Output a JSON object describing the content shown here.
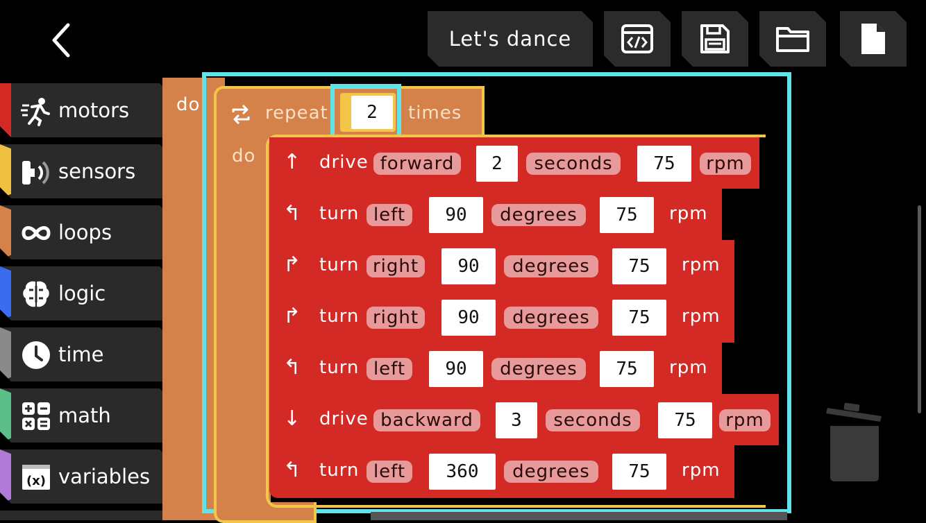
{
  "toolbar": {
    "project_name": "Let's dance",
    "back_icon": "chevron-left-icon",
    "code_icon": "code-window-icon",
    "save_icon": "floppy-disk-icon",
    "open_icon": "folder-icon",
    "new_icon": "new-file-icon"
  },
  "sidebar": {
    "items": [
      {
        "label": "motors",
        "icon": "running-person-icon",
        "color": "#d42a26"
      },
      {
        "label": "sensors",
        "icon": "sensor-icon",
        "color": "#f0c040"
      },
      {
        "label": "loops",
        "icon": "infinity-icon",
        "color": "#d4824a"
      },
      {
        "label": "logic",
        "icon": "brain-icon",
        "color": "#3a6cf0"
      },
      {
        "label": "time",
        "icon": "clock-icon",
        "color": "#8a8a8a"
      },
      {
        "label": "math",
        "icon": "math-operators-icon",
        "color": "#5cbf8a"
      },
      {
        "label": "variables",
        "icon": "variable-x-icon",
        "color": "#b07ad8"
      }
    ]
  },
  "workspace": {
    "outer_do_label": "do",
    "repeat_block": {
      "label": "repeat",
      "count": "2",
      "suffix": "times",
      "do_label": "do",
      "color": "#d4824a"
    },
    "commands": [
      {
        "arrow": "↑",
        "verb": "drive",
        "direction": "forward",
        "value": "2",
        "unit": "seconds",
        "speed": "75",
        "speed_unit": "rpm",
        "unit_pill": true
      },
      {
        "arrow": "↰",
        "verb": "turn",
        "direction": "left",
        "value": "90",
        "unit": "degrees",
        "speed": "75",
        "speed_unit": "rpm",
        "unit_pill": false
      },
      {
        "arrow": "↱",
        "verb": "turn",
        "direction": "right",
        "value": "90",
        "unit": "degrees",
        "speed": "75",
        "speed_unit": "rpm",
        "unit_pill": false
      },
      {
        "arrow": "↱",
        "verb": "turn",
        "direction": "right",
        "value": "90",
        "unit": "degrees",
        "speed": "75",
        "speed_unit": "rpm",
        "unit_pill": false
      },
      {
        "arrow": "↰",
        "verb": "turn",
        "direction": "left",
        "value": "90",
        "unit": "degrees",
        "speed": "75",
        "speed_unit": "rpm",
        "unit_pill": false
      },
      {
        "arrow": "↓",
        "verb": "drive",
        "direction": "backward",
        "value": "3",
        "unit": "seconds",
        "speed": "75",
        "speed_unit": "rpm",
        "unit_pill": true
      },
      {
        "arrow": "↰",
        "verb": "turn",
        "direction": "left",
        "value": "360",
        "unit": "degrees",
        "speed": "75",
        "speed_unit": "rpm",
        "unit_pill": false
      }
    ],
    "command_color": "#d42a26",
    "highlight_color": "#5fe4ea",
    "trash_icon": "trash-can-icon"
  }
}
